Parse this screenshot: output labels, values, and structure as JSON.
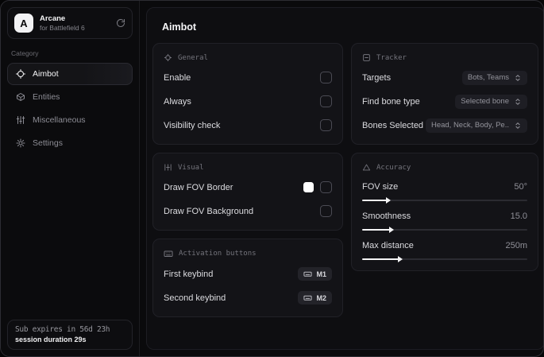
{
  "app": {
    "logo_letter": "A",
    "name": "Arcane",
    "subtitle": "for Battlefield 6"
  },
  "sidebar": {
    "category_label": "Category",
    "items": [
      {
        "label": "Aimbot"
      },
      {
        "label": "Entities"
      },
      {
        "label": "Miscellaneous"
      },
      {
        "label": "Settings"
      }
    ],
    "subscription": {
      "expires": "Sub expires in 56d 23h",
      "session": "session duration 29s"
    }
  },
  "main": {
    "title": "Aimbot",
    "panels": {
      "general": {
        "title": "General",
        "rows": [
          {
            "label": "Enable",
            "checked": false
          },
          {
            "label": "Always",
            "checked": false
          },
          {
            "label": "Visibility check",
            "checked": false
          }
        ]
      },
      "visual": {
        "title": "Visual",
        "rows": [
          {
            "label": "Draw FOV Border",
            "swatch": "#ffffff",
            "checked": false
          },
          {
            "label": "Draw FOV Background",
            "checked": false
          }
        ]
      },
      "activation": {
        "title": "Activation buttons",
        "rows": [
          {
            "label": "First keybind",
            "key": "M1"
          },
          {
            "label": "Second keybind",
            "key": "M2"
          }
        ]
      },
      "tracker": {
        "title": "Tracker",
        "rows": [
          {
            "label": "Targets",
            "value": "Bots, Teams"
          },
          {
            "label": "Find bone type",
            "value": "Selected bone"
          },
          {
            "label": "Bones Selected",
            "value": "Head, Neck, Body, Pe.."
          }
        ]
      },
      "accuracy": {
        "title": "Accuracy",
        "sliders": [
          {
            "label": "FOV size",
            "value": "50°",
            "percent": 15
          },
          {
            "label": "Smoothness",
            "value": "15.0",
            "percent": 17
          },
          {
            "label": "Max distance",
            "value": "250m",
            "percent": 22
          }
        ]
      }
    }
  },
  "colors": {
    "swatch_fov_border": "#ffffff",
    "accent": "#f5f5f6"
  }
}
